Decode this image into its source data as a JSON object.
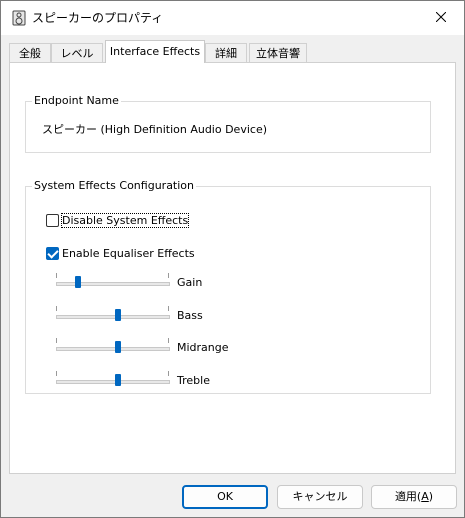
{
  "window": {
    "title": "スピーカーのプロパティ"
  },
  "tabs": [
    {
      "label": "全般"
    },
    {
      "label": "レベル"
    },
    {
      "label": "Interface Effects"
    },
    {
      "label": "詳細"
    },
    {
      "label": "立体音響"
    }
  ],
  "endpoint": {
    "group_label": "Endpoint Name",
    "device_name": "スピーカー (High Definition Audio Device)"
  },
  "system_effects": {
    "group_label": "System Effects Configuration",
    "disable_label": "Disable System Effects",
    "disable_checked": false,
    "equaliser_label": "Enable Equaliser Effects",
    "equaliser_checked": true,
    "sliders": [
      {
        "label": "Gain",
        "value": 0.2
      },
      {
        "label": "Bass",
        "value": 0.55
      },
      {
        "label": "Midrange",
        "value": 0.55
      },
      {
        "label": "Treble",
        "value": 0.55
      }
    ]
  },
  "buttons": {
    "ok": "OK",
    "cancel": "キャンセル",
    "apply": "適用(",
    "apply_key": "A",
    "apply_close": ")"
  },
  "colors": {
    "accent": "#0067c0"
  }
}
